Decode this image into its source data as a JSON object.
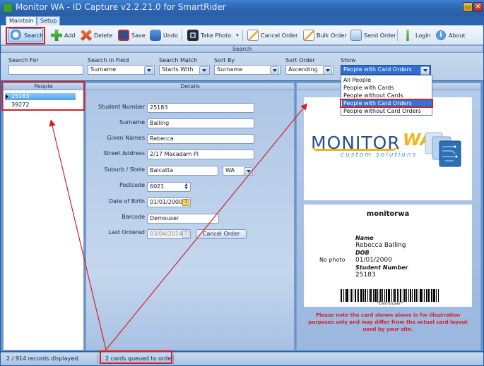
{
  "window": {
    "title": "Monitor WA - ID Capture v2.2.21.0 for SmartRider",
    "restore_glyph": "▭",
    "close_glyph": "✕"
  },
  "tabs": [
    {
      "label": "Maintain",
      "active": true
    },
    {
      "label": "Setup",
      "active": false
    }
  ],
  "toolbar": {
    "search": "Search",
    "add": "Add",
    "delete": "Delete",
    "save": "Save",
    "undo": "Undo",
    "take_photo": "Take Photo",
    "cancel_order": "Cancel Order",
    "bulk_order": "Bulk Order",
    "send_order": "Send Order",
    "login": "Login",
    "about": "About"
  },
  "search": {
    "header": "Search",
    "search_for_label": "Search For",
    "search_for_value": "",
    "search_in_label": "Search in Field",
    "search_in_value": "Surname",
    "match_label": "Search Match",
    "match_value": "Starts With",
    "sort_by_label": "Sort By",
    "sort_by_value": "Surname",
    "sort_order_label": "Sort Order",
    "sort_order_value": "Ascending",
    "show_label": "Show",
    "show_value": "People with Card Orders",
    "show_options": [
      "All People",
      "People with Cards",
      "People without Cards",
      "People with Card Orders",
      "People without Card Orders"
    ]
  },
  "people": {
    "header": "People",
    "rows": [
      "25183",
      "39272"
    ]
  },
  "details": {
    "header": "Details",
    "student_number_label": "Student Number",
    "student_number": "25183",
    "surname_label": "Surname",
    "surname": "Balling",
    "given_names_label": "Given Names",
    "given_names": "Rebecca",
    "street_label": "Street Address",
    "street": "2/17 Macadam Pl",
    "suburb_label": "Suburb / State",
    "suburb": "Balcatta",
    "state": "WA",
    "postcode_label": "Postcode",
    "postcode": "6021",
    "dob_label": "Date of Birth",
    "dob": "01/01/2000",
    "barcode_label": "Barcode",
    "barcode": "Demouser",
    "last_ordered_label": "Last Ordered",
    "last_ordered": "03/04/2014",
    "cancel_order_button": "Cancel Order"
  },
  "card": {
    "logo_main": "MONITOR",
    "logo_accent": "WA",
    "logo_tagline": "custom solutions",
    "back_title": "monitorwa",
    "name_label": "Name",
    "name": "Rebecca Balling",
    "dob_label": "DOB",
    "dob": "01/01/2000",
    "student_number_label": "Student Number",
    "student_number": "25183",
    "no_photo": "No photo",
    "barcode_text": "*Demouser*",
    "note": "Please note the card shown above is for illustration purposes only and may differ from the actual card layout used by your site."
  },
  "status": {
    "records": "2 / 914 records displayed.",
    "queued": "2 cards queued to order."
  },
  "colors": {
    "annotation_red": "#d6202a",
    "selection_blue": "#3275d6"
  }
}
